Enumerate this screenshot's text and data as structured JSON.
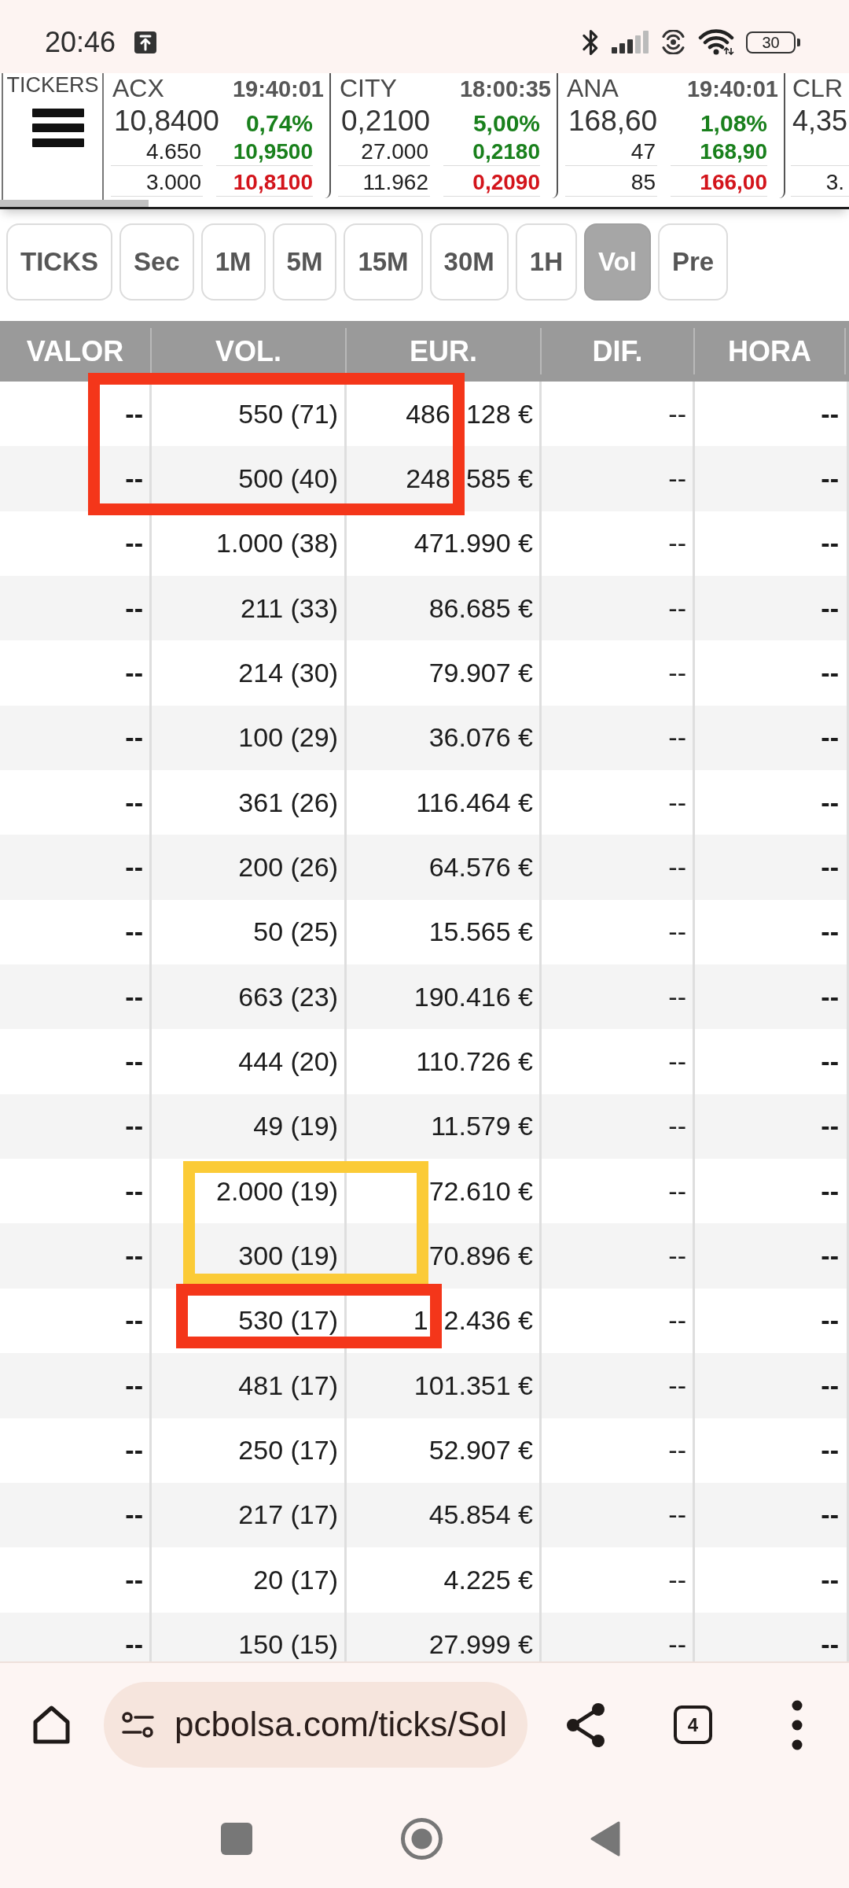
{
  "status_bar": {
    "time": "20:46",
    "battery": "30"
  },
  "tickers": {
    "label": "TICKERS",
    "items": [
      {
        "symbol": "ACX",
        "time": "19:40:01",
        "price": "10,8400",
        "change": "0,74%",
        "rising": true,
        "quote_1": {
          "volume": "4.650",
          "price": "10,9500"
        },
        "quote_2": {
          "volume": "3.000",
          "price": "10,8100"
        }
      },
      {
        "symbol": "CITY",
        "time": "18:00:35",
        "price": "0,2100",
        "change": "5,00%",
        "rising": true,
        "quote_1": {
          "volume": "27.000",
          "price": "0,2180"
        },
        "quote_2": {
          "volume": "11.962",
          "price": "0,2090"
        }
      },
      {
        "symbol": "ANA",
        "time": "19:40:01",
        "price": "168,60",
        "change": "1,08%",
        "rising": true,
        "quote_1": {
          "volume": "47",
          "price": "168,90"
        },
        "quote_2": {
          "volume": "85",
          "price": "166,00"
        }
      },
      {
        "symbol": "CLR",
        "price": "4,35",
        "quote_2": {
          "volume": "3."
        }
      }
    ]
  },
  "interval_tabs": [
    {
      "label": "TICKS",
      "selected": false
    },
    {
      "label": "Sec",
      "selected": false
    },
    {
      "label": "1M",
      "selected": false
    },
    {
      "label": "5M",
      "selected": false
    },
    {
      "label": "15M",
      "selected": false
    },
    {
      "label": "30M",
      "selected": false
    },
    {
      "label": "1H",
      "selected": false
    },
    {
      "label": "Vol",
      "selected": true
    },
    {
      "label": "Pre",
      "selected": false
    }
  ],
  "table": {
    "columns": [
      "VALOR",
      "VOL.",
      "EUR.",
      "DIF.",
      "HORA"
    ],
    "rows": [
      [
        "--",
        "550 (71)",
        [
          "486",
          "128 €"
        ],
        "--",
        "--"
      ],
      [
        "--",
        "500 (40)",
        [
          "248",
          "585 €"
        ],
        "--",
        "--"
      ],
      [
        "--",
        "1.000 (38)",
        "471.990 €",
        "--",
        "--"
      ],
      [
        "--",
        "211 (33)",
        "86.685 €",
        "--",
        "--"
      ],
      [
        "--",
        "214 (30)",
        "79.907 €",
        "--",
        "--"
      ],
      [
        "--",
        "100 (29)",
        "36.076 €",
        "--",
        "--"
      ],
      [
        "--",
        "361 (26)",
        "116.464 €",
        "--",
        "--"
      ],
      [
        "--",
        "200 (26)",
        "64.576 €",
        "--",
        "--"
      ],
      [
        "--",
        "50 (25)",
        "15.565 €",
        "--",
        "--"
      ],
      [
        "--",
        "663 (23)",
        "190.416 €",
        "--",
        "--"
      ],
      [
        "--",
        "444 (20)",
        "110.726 €",
        "--",
        "--"
      ],
      [
        "--",
        "49 (19)",
        "11.579 €",
        "--",
        "--"
      ],
      [
        "--",
        "2.000 (19)",
        "72.610 €",
        "--",
        "--"
      ],
      [
        "--",
        "300 (19)",
        "70.896 €",
        "--",
        "--"
      ],
      [
        "--",
        "530 (17)",
        [
          "1",
          "2.436 €"
        ],
        "--",
        "--"
      ],
      [
        "--",
        "481 (17)",
        "101.351 €",
        "--",
        "--"
      ],
      [
        "--",
        "250 (17)",
        "52.907 €",
        "--",
        "--"
      ],
      [
        "--",
        "217 (17)",
        "45.854 €",
        "--",
        "--"
      ],
      [
        "--",
        "20 (17)",
        "4.225 €",
        "--",
        "--"
      ],
      [
        "--",
        "150 (15)",
        "27.999 €",
        "--",
        "--"
      ]
    ]
  },
  "annotations": [
    {
      "color": "#f4361a"
    },
    {
      "color": "#fbcb37"
    },
    {
      "color": "#f4361a"
    }
  ],
  "browser": {
    "url": "pcbolsa.com/ticks/Sol",
    "tab_count": "4"
  }
}
